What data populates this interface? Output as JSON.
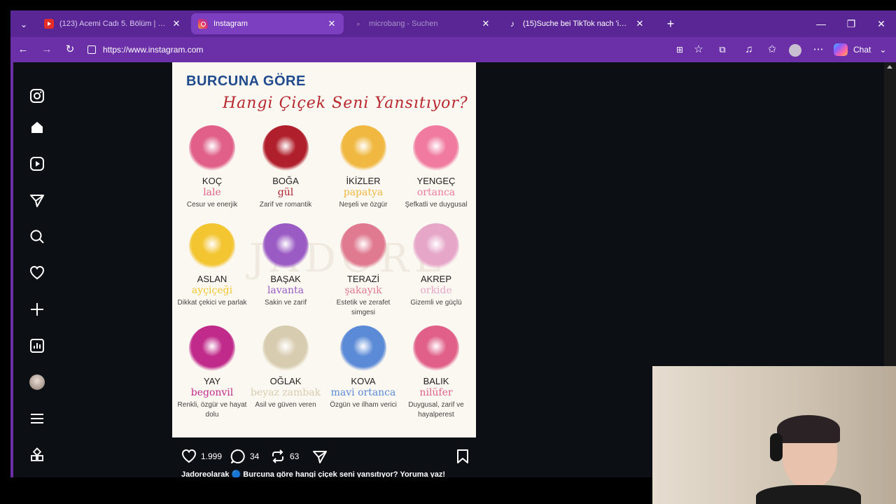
{
  "tabs": [
    {
      "title": "(123) Acemi Cadı 5. Bölüm | Full B...",
      "favicon": "youtube-icon",
      "active": false
    },
    {
      "title": "Instagram",
      "favicon": "instagram-icon",
      "active": true
    },
    {
      "title": "microbang - Suchen",
      "favicon": "search-icon",
      "active": false
    },
    {
      "title": "(15)Suche bei TikTok nach 'idol ho...",
      "favicon": "tiktok-icon",
      "active": false
    }
  ],
  "address_bar": {
    "url": "https://www.instagram.com"
  },
  "toolbar": {
    "chat_label": "Chat"
  },
  "post": {
    "title_line1": "BURCUNA GÖRE",
    "title_line2": "Hangi Çiçek Seni Yansıtıyor?",
    "watermark": "JADORE",
    "items": [
      {
        "sign": "KOÇ",
        "flower": "lale",
        "desc": "Cesur ve enerjik",
        "color": "#e0608a"
      },
      {
        "sign": "BOĞA",
        "flower": "gül",
        "desc": "Zarif ve romantik",
        "color": "#b0202c"
      },
      {
        "sign": "İKİZLER",
        "flower": "papatya",
        "desc": "Neşeli ve özgür",
        "color": "#f0b840"
      },
      {
        "sign": "YENGEÇ",
        "flower": "ortanca",
        "desc": "Şefkatli ve duygusal",
        "color": "#f07aa0"
      },
      {
        "sign": "ASLAN",
        "flower": "ayçiçeği",
        "desc": "Dikkat çekici ve parlak",
        "color": "#f3c531"
      },
      {
        "sign": "BAŞAK",
        "flower": "lavanta",
        "desc": "Sakin ve zarif",
        "color": "#9a5bc4"
      },
      {
        "sign": "TERAZİ",
        "flower": "şakayık",
        "desc": "Estetik ve zerafet simgesi",
        "color": "#e07a90"
      },
      {
        "sign": "AKREP",
        "flower": "orkide",
        "desc": "Gizemli ve güçlü",
        "color": "#e6a6c8"
      },
      {
        "sign": "YAY",
        "flower": "begonvil",
        "desc": "Renkli, özgür ve hayat dolu",
        "color": "#c02a8a"
      },
      {
        "sign": "OĞLAK",
        "flower": "beyaz zambak",
        "desc": "Asil ve güven veren",
        "color": "#d8ccb0"
      },
      {
        "sign": "KOVA",
        "flower": "mavi ortanca",
        "desc": "Özgün ve ilham verici",
        "color": "#5b8ad6"
      },
      {
        "sign": "BALIK",
        "flower": "nilüfer",
        "desc": "Duygusal, zarif ve hayalperest",
        "color": "#e0608a"
      }
    ],
    "likes": "1.999",
    "comments": "34",
    "reposts": "63",
    "caption": "Jadoreolarak 🔵 Burcuna göre hangi çiçek seni yansıtıyor? Yoruma yaz!"
  },
  "colors": {
    "browser_frame": "#6b2fa8",
    "tabbar": "#5a2696",
    "page_bg": "#0c1014"
  }
}
